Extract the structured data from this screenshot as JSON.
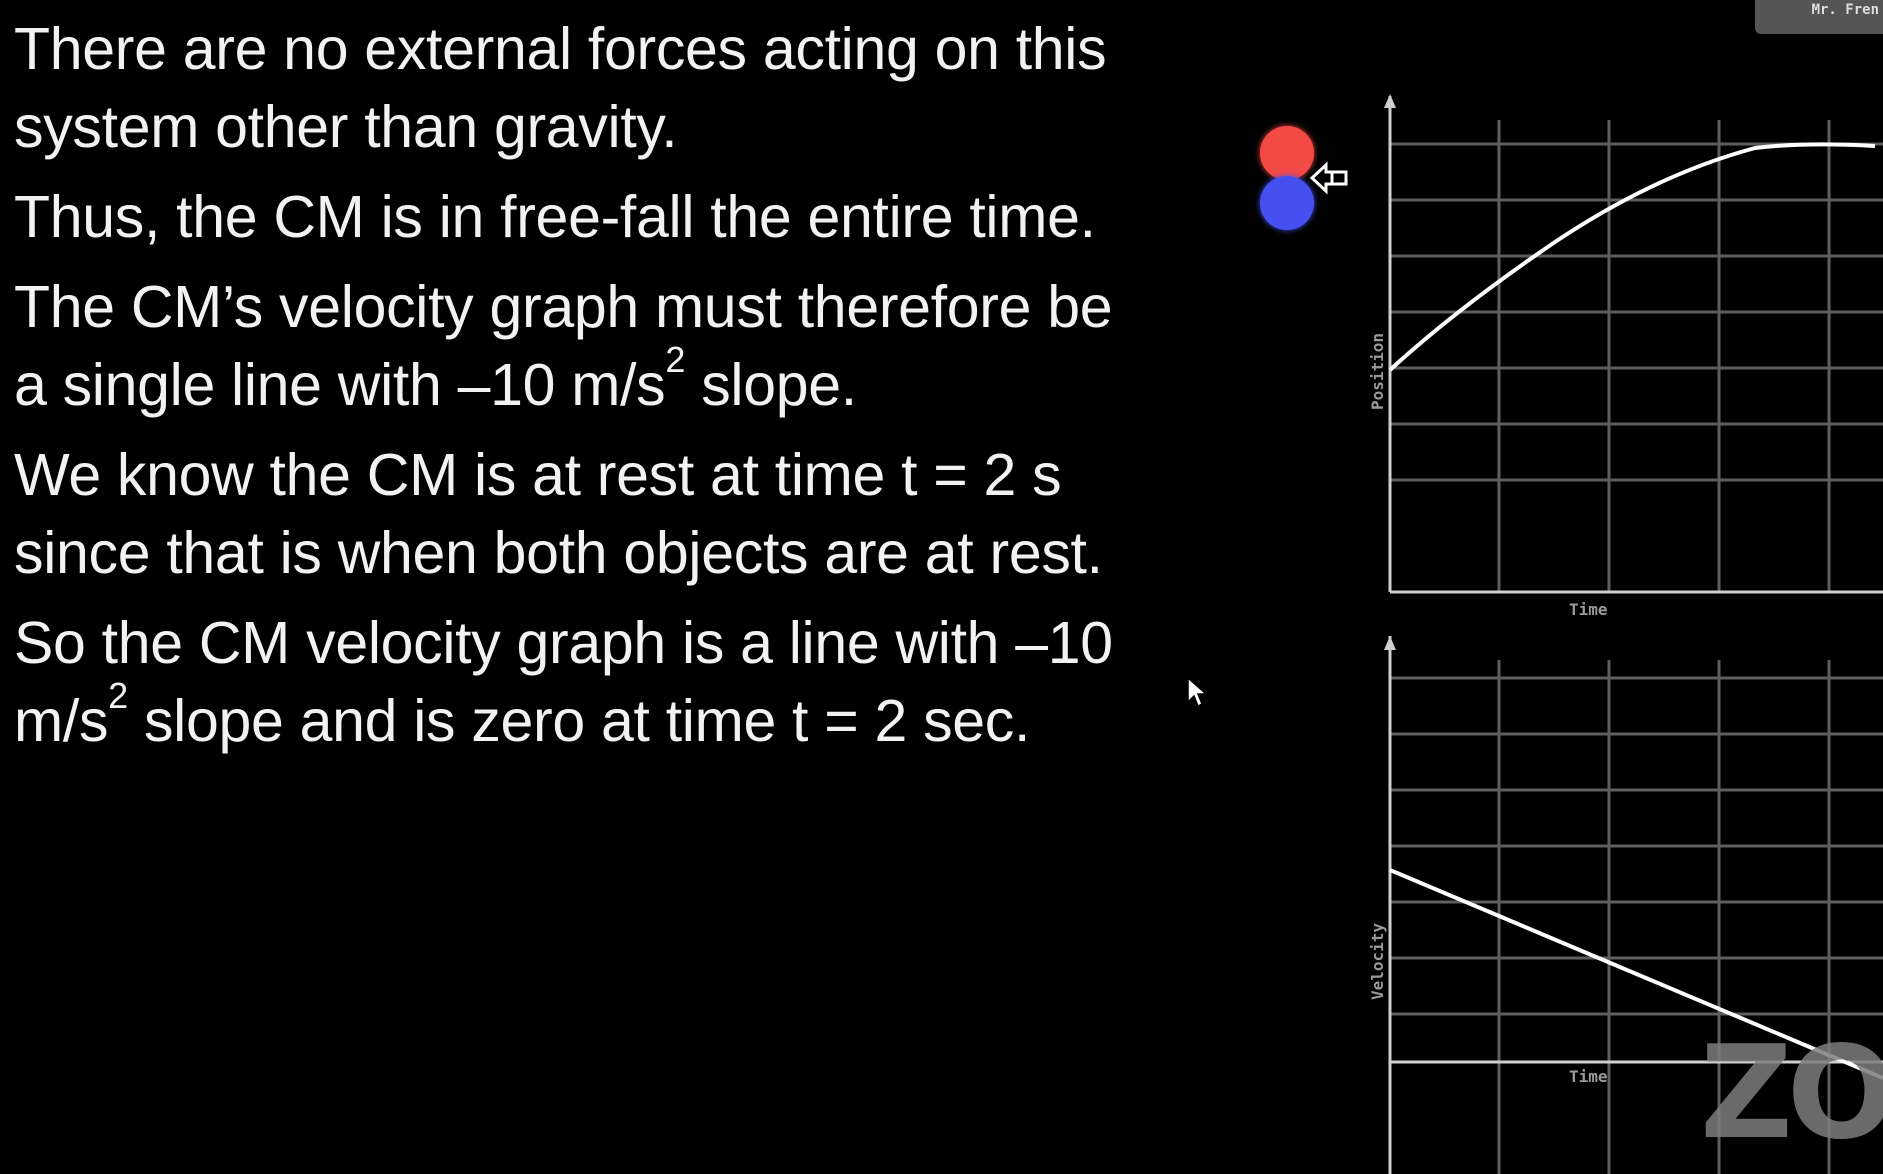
{
  "slide": {
    "paragraphs": [
      [
        "There are no external forces acting on this",
        "system other than gravity."
      ],
      [
        "Thus, the CM is in free-fall the entire time."
      ],
      [
        "The CM’s velocity graph must therefore be",
        "a single line with –10 m/s² slope."
      ],
      [
        "We know the CM is at rest at time t = 2 s",
        "since that is when both objects are at rest."
      ],
      [
        "So the CM velocity graph is a line with –10",
        "m/s² slope and is zero at time t = 2 sec."
      ]
    ]
  },
  "graphs": {
    "position": {
      "ylabel": "Position",
      "xlabel": "Time"
    },
    "velocity": {
      "ylabel": "Velocity",
      "xlabel": "Time"
    }
  },
  "overlay": {
    "name_tag": "Mr. Fren",
    "watermark": "ZOO"
  },
  "colors": {
    "background": "#000000",
    "text": "#f2f2f2",
    "red_ball": "#f24a45",
    "blue_ball": "#4650f0",
    "grid": "#5e5e5e",
    "curve": "#ffffff"
  },
  "icons": [
    "red-ball-icon",
    "blue-ball-icon",
    "arrow-left-icon",
    "mouse-cursor-icon"
  ]
}
